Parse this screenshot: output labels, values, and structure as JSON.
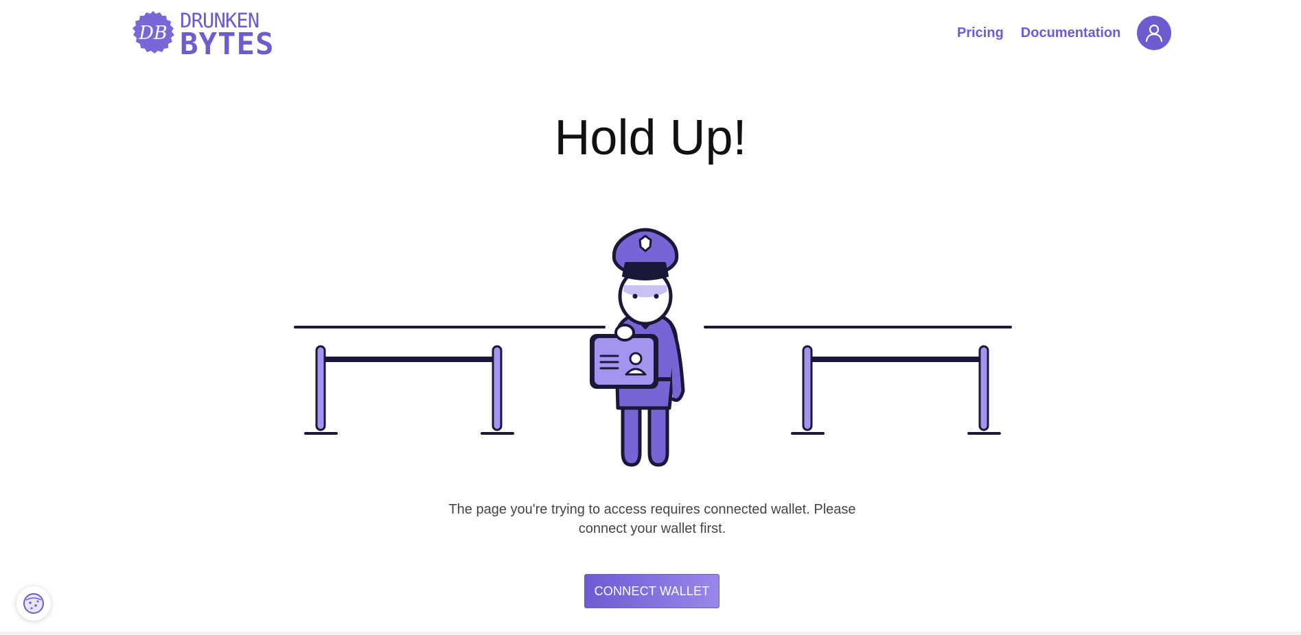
{
  "header": {
    "logo": {
      "badge_text": "DB",
      "line1": "DRUNKEN",
      "line2": "BYTES"
    },
    "nav": {
      "pricing": "Pricing",
      "documentation": "Documentation"
    },
    "avatar_icon": "user-icon"
  },
  "main": {
    "title": "Hold Up!",
    "illustration_icon": "police-guard-illustration",
    "message": "The page you're trying to access requires connected wallet. Please connect your wallet first.",
    "connect_button": "CONNECT WALLET"
  },
  "cookie_button_icon": "cookie-icon",
  "colors": {
    "accent": "#6d5bd0",
    "accent_light": "#a394f0",
    "outline": "#1a1838",
    "title": "#111111",
    "text": "#444444"
  }
}
